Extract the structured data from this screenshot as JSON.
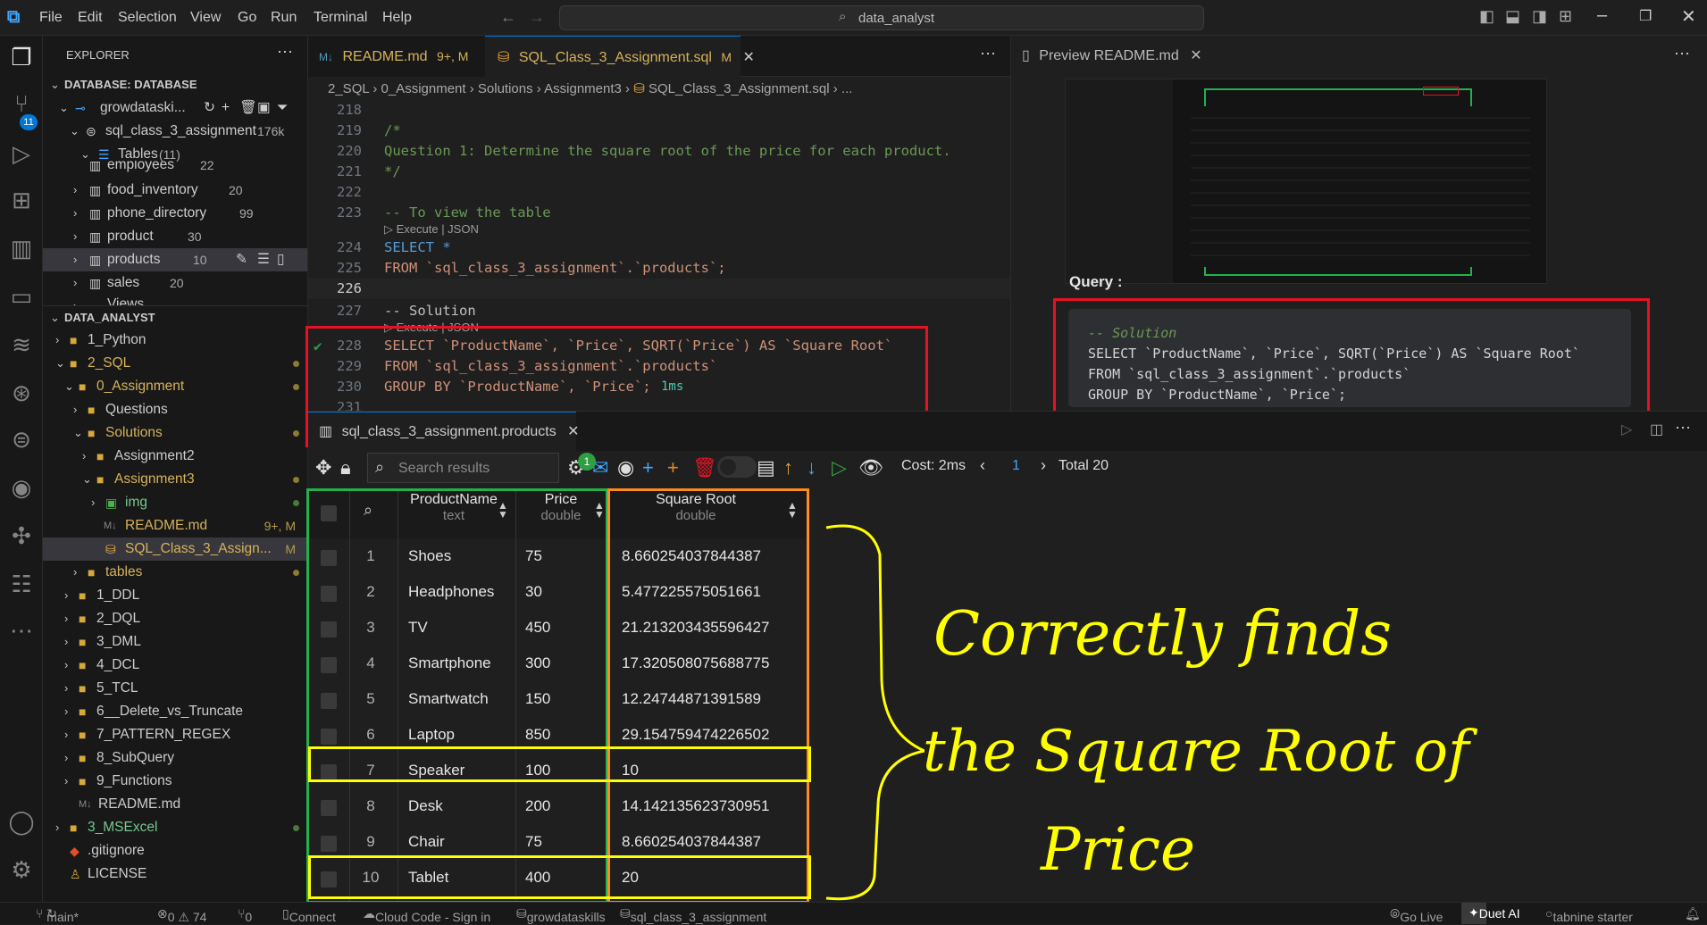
{
  "titlebar": {
    "menu": [
      "File",
      "Edit",
      "Selection",
      "View",
      "Go",
      "Run",
      "Terminal",
      "Help"
    ],
    "search": "data_analyst"
  },
  "sidebar": {
    "title": "EXPLORER",
    "database_section": "DATABASE: DATABASE",
    "connection": "growdataski...",
    "schema": "sql_class_3_assignment",
    "schema_size": "176k",
    "tables_label": "Tables",
    "tables_count": "(11)",
    "tables": [
      {
        "name": "employees",
        "count": "22"
      },
      {
        "name": "food_inventory",
        "count": "20"
      },
      {
        "name": "phone_directory",
        "count": "99"
      },
      {
        "name": "product",
        "count": "30"
      },
      {
        "name": "products",
        "count": "10"
      },
      {
        "name": "sales",
        "count": "20"
      }
    ],
    "views_label": "Views",
    "workspace_section": "DATA_ANALYST",
    "items": [
      {
        "label": "1_Python"
      },
      {
        "label": "2_SQL"
      },
      {
        "label": "0_Assignment"
      },
      {
        "label": "Questions"
      },
      {
        "label": "Solutions"
      },
      {
        "label": "Assignment2"
      },
      {
        "label": "Assignment3"
      },
      {
        "label": "img"
      },
      {
        "label": "README.md",
        "badge": "9+, M"
      },
      {
        "label": "SQL_Class_3_Assign...",
        "badge": "M"
      },
      {
        "label": "tables"
      },
      {
        "label": "1_DDL"
      },
      {
        "label": "2_DQL"
      },
      {
        "label": "3_DML"
      },
      {
        "label": "4_DCL"
      },
      {
        "label": "5_TCL"
      },
      {
        "label": "6__Delete_vs_Truncate"
      },
      {
        "label": "7_PATTERN_REGEX"
      },
      {
        "label": "8_SubQuery"
      },
      {
        "label": "9_Functions"
      },
      {
        "label": "README.md"
      },
      {
        "label": "3_MSExcel"
      },
      {
        "label": ".gitignore"
      },
      {
        "label": "LICENSE"
      }
    ],
    "activity_badge": "11"
  },
  "editor": {
    "tabs": [
      {
        "label": "README.md",
        "status": "9+, M"
      },
      {
        "label": "SQL_Class_3_Assignment.sql",
        "status": "M"
      }
    ],
    "breadcrumb": [
      "2_SQL",
      "0_Assignment",
      "Solutions",
      "Assignment3",
      "SQL_Class_3_Assignment.sql",
      "..."
    ],
    "lines": [
      {
        "n": "218",
        "t": ""
      },
      {
        "n": "219",
        "t": "/*"
      },
      {
        "n": "220",
        "t": "Question 1: Determine the square root of the price for each product."
      },
      {
        "n": "221",
        "t": "*/"
      },
      {
        "n": "222",
        "t": ""
      },
      {
        "n": "223",
        "t": "-- To view the table"
      },
      {
        "n": "224",
        "t": "SELECT *"
      },
      {
        "n": "225",
        "t": "FROM `sql_class_3_assignment`.`products`;"
      },
      {
        "n": "226",
        "t": ""
      },
      {
        "n": "227",
        "t": "-- Solution"
      },
      {
        "n": "228",
        "t": "SELECT `ProductName`, `Price`, SQRT(`Price`) AS `Square Root`"
      },
      {
        "n": "229",
        "t": "FROM `sql_class_3_assignment`.`products`"
      },
      {
        "n": "230",
        "t": "GROUP BY `ProductName`, `Price`;"
      },
      {
        "n": "231",
        "t": ""
      }
    ],
    "codelens": "Execute | JSON",
    "timing": "1ms"
  },
  "preview": {
    "tab": "Preview README.md",
    "query_label": "Query :",
    "code": [
      "-- Solution",
      "SELECT `ProductName`, `Price`, SQRT(`Price`) AS `Square Root`",
      "FROM `sql_class_3_assignment`.`products`",
      "GROUP BY `ProductName`, `Price`;"
    ]
  },
  "results": {
    "tab": "sql_class_3_assignment.products",
    "search_placeholder": "Search results",
    "mail_badge": "1",
    "cost": "Cost: 2ms",
    "page": "1",
    "total": "Total 20",
    "columns": [
      {
        "name": "ProductName",
        "type": "text"
      },
      {
        "name": "Price",
        "type": "double"
      },
      {
        "name": "Square Root",
        "type": "double"
      }
    ],
    "rows": [
      {
        "n": "1",
        "name": "Shoes",
        "price": "75",
        "sqrt": "8.660254037844387"
      },
      {
        "n": "2",
        "name": "Headphones",
        "price": "30",
        "sqrt": "5.477225575051661"
      },
      {
        "n": "3",
        "name": "TV",
        "price": "450",
        "sqrt": "21.213203435596427"
      },
      {
        "n": "4",
        "name": "Smartphone",
        "price": "300",
        "sqrt": "17.320508075688775"
      },
      {
        "n": "5",
        "name": "Smartwatch",
        "price": "150",
        "sqrt": "12.24744871391589"
      },
      {
        "n": "6",
        "name": "Laptop",
        "price": "850",
        "sqrt": "29.154759474226502"
      },
      {
        "n": "7",
        "name": "Speaker",
        "price": "100",
        "sqrt": "10"
      },
      {
        "n": "8",
        "name": "Desk",
        "price": "200",
        "sqrt": "14.142135623730951"
      },
      {
        "n": "9",
        "name": "Chair",
        "price": "75",
        "sqrt": "8.660254037844387"
      },
      {
        "n": "10",
        "name": "Tablet",
        "price": "400",
        "sqrt": "20"
      }
    ]
  },
  "annotation": {
    "line1": "Correctly finds",
    "line2": "the Square Root of",
    "line3": "Price"
  },
  "statusbar": {
    "branch": "main*",
    "problems": "0 ⚠ 74",
    "ports": "0",
    "connect": "Connect",
    "cloud": "Cloud Code - Sign in",
    "db": "growdataskills",
    "schema": "sql_class_3_assignment",
    "golive": "Go Live",
    "duet": "Duet AI",
    "tabnine": "tabnine starter"
  },
  "colors": {
    "annotation_red": "#e81123",
    "annotation_yellow": "#ffff00",
    "annotation_green": "#22b14c",
    "annotation_orange": "#ff8c1a",
    "accent_blue": "#0078d4"
  }
}
